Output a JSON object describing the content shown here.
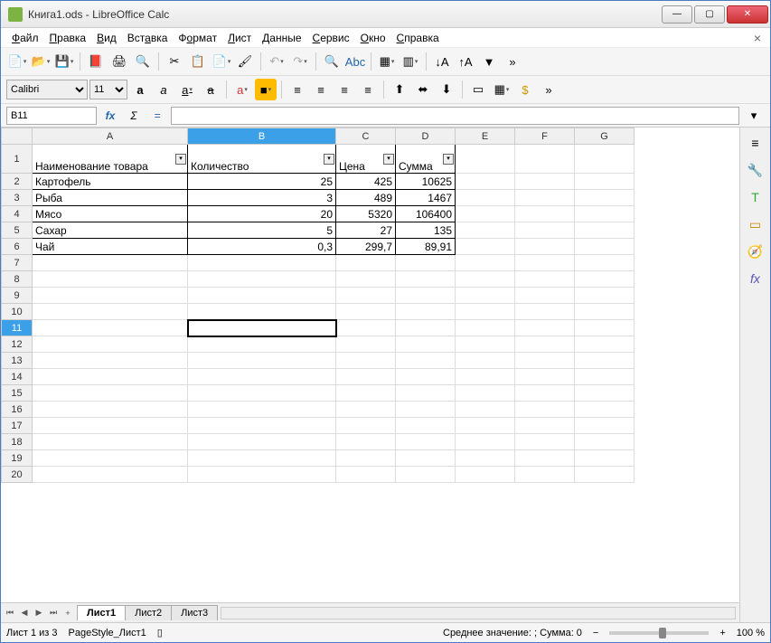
{
  "window": {
    "title": "Книга1.ods - LibreOffice Calc"
  },
  "menu": [
    "Файл",
    "Правка",
    "Вид",
    "Вставка",
    "Формат",
    "Лист",
    "Данные",
    "Сервис",
    "Окно",
    "Справка"
  ],
  "font": {
    "name": "Calibri",
    "size": "11"
  },
  "cellref": "B11",
  "sheets": {
    "tabs": [
      "Лист1",
      "Лист2",
      "Лист3"
    ],
    "active": 0
  },
  "status": {
    "sheet": "Лист 1 из 3",
    "style": "PageStyle_Лист1",
    "summary": "Среднее значение: ; Сумма: 0",
    "zoom": "100 %"
  },
  "columns": [
    "A",
    "B",
    "C",
    "D",
    "E",
    "F",
    "G"
  ],
  "headers": {
    "a": "Наименование товара",
    "b": "Количество",
    "c": "Цена",
    "d": "Сумма"
  },
  "rows": [
    {
      "a": "Картофель",
      "b": "25",
      "c": "425",
      "d": "10625"
    },
    {
      "a": "Рыба",
      "b": "3",
      "c": "489",
      "d": "1467"
    },
    {
      "a": "Мясо",
      "b": "20",
      "c": "5320",
      "d": "106400"
    },
    {
      "a": "Сахар",
      "b": "5",
      "c": "27",
      "d": "135"
    },
    {
      "a": "Чай",
      "b": "0,3",
      "c": "299,7",
      "d": "89,91"
    }
  ],
  "chart_data": {
    "type": "table",
    "columns": [
      "Наименование товара",
      "Количество",
      "Цена",
      "Сумма"
    ],
    "rows": [
      [
        "Картофель",
        25,
        425,
        10625
      ],
      [
        "Рыба",
        3,
        489,
        1467
      ],
      [
        "Мясо",
        20,
        5320,
        106400
      ],
      [
        "Сахар",
        5,
        27,
        135
      ],
      [
        "Чай",
        0.3,
        299.7,
        89.91
      ]
    ]
  }
}
